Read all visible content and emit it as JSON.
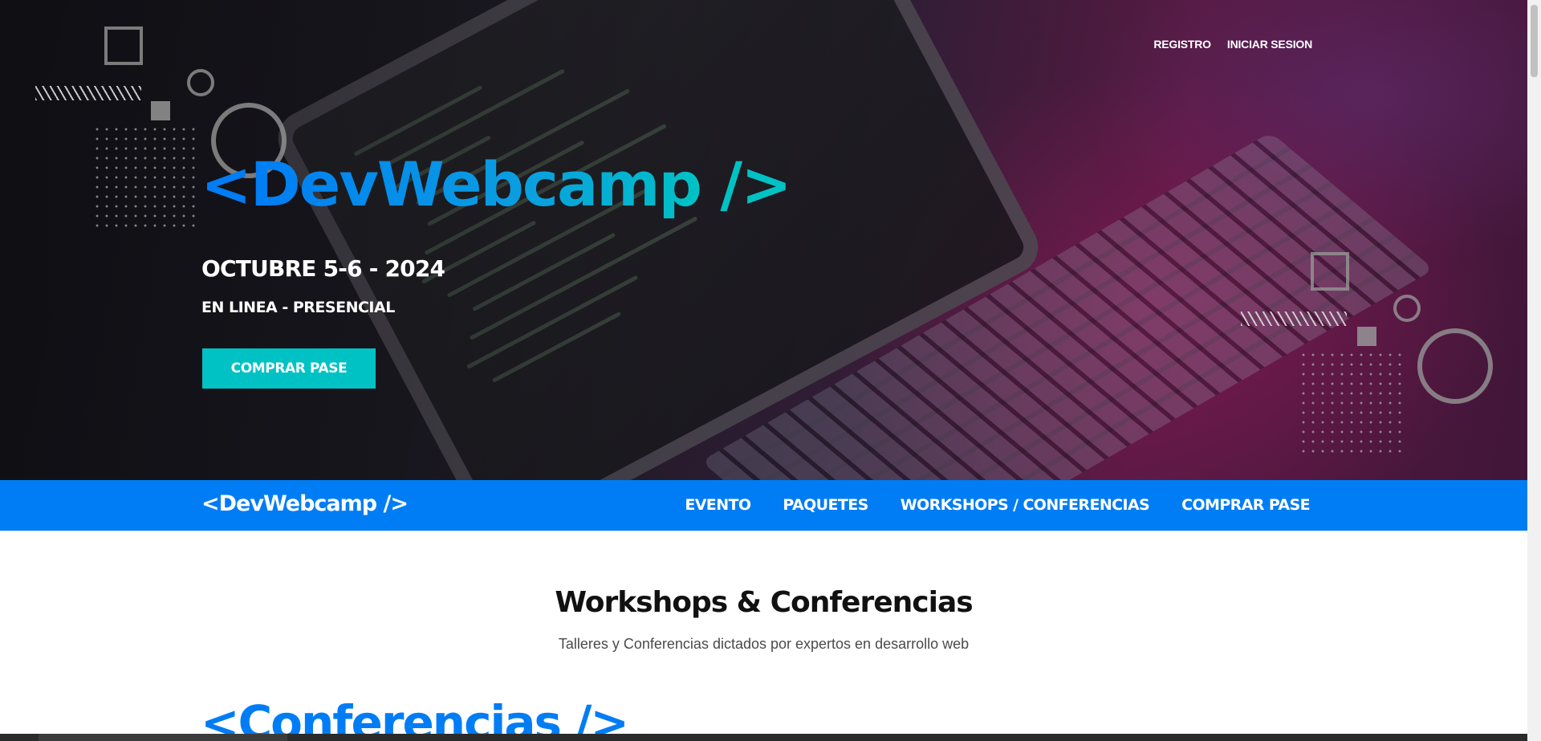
{
  "hero": {
    "nav": {
      "register": "REGISTRO",
      "login": "INICIAR SESION"
    },
    "logo": {
      "open": "<",
      "name": "DevWebcamp",
      "close": " />"
    },
    "date": "OCTUBRE 5-6 - 2024",
    "mode": "EN LINEA - PRESENCIAL",
    "cta": "COMPRAR PASE"
  },
  "navbar": {
    "logo": "<DevWebcamp />",
    "links": [
      "EVENTO",
      "PAQUETES",
      "WORKSHOPS / CONFERENCIAS",
      "COMPRAR PASE"
    ]
  },
  "content": {
    "title": "Workshops & Conferencias",
    "description": "Talleres y Conferencias dictados por expertos en desarrollo web",
    "conferences_heading": "<Conferencias />"
  },
  "colors": {
    "primary": "#007df4",
    "secondary": "#00c2c5",
    "text_dark": "#111111"
  }
}
